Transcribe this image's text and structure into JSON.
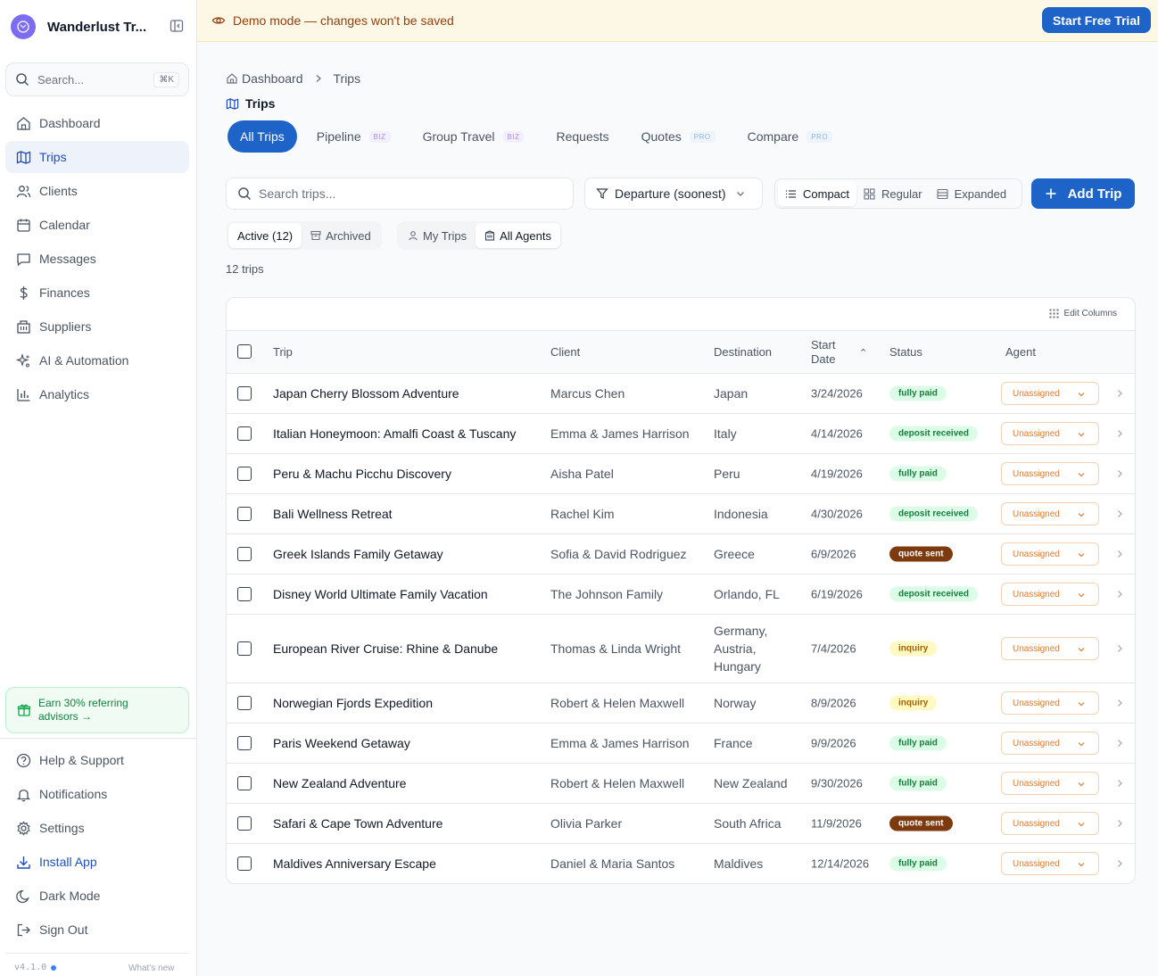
{
  "app": {
    "name": "Wanderlust Tr...",
    "version": "v4.1.0",
    "whats_new": "What's new"
  },
  "search": {
    "placeholder": "Search...",
    "shortcut": "⌘K"
  },
  "sidebar": {
    "items": [
      {
        "label": "Dashboard",
        "icon": "home-icon",
        "active": false
      },
      {
        "label": "Trips",
        "icon": "map-icon",
        "active": true
      },
      {
        "label": "Clients",
        "icon": "users-icon",
        "active": false
      },
      {
        "label": "Calendar",
        "icon": "calendar-icon",
        "active": false
      },
      {
        "label": "Messages",
        "icon": "message-icon",
        "active": false
      },
      {
        "label": "Finances",
        "icon": "dollar-icon",
        "active": false
      },
      {
        "label": "Suppliers",
        "icon": "building-icon",
        "active": false
      },
      {
        "label": "AI & Automation",
        "icon": "sparkles-icon",
        "active": false
      },
      {
        "label": "Analytics",
        "icon": "bar-chart-icon",
        "active": false
      }
    ],
    "referral": "Earn 30% referring advisors →",
    "bottom": [
      {
        "label": "Help & Support",
        "icon": "help-icon"
      },
      {
        "label": "Notifications",
        "icon": "bell-icon"
      },
      {
        "label": "Settings",
        "icon": "gear-icon"
      },
      {
        "label": "Install App",
        "icon": "download-icon"
      },
      {
        "label": "Dark Mode",
        "icon": "moon-icon"
      },
      {
        "label": "Sign Out",
        "icon": "sign-out-icon"
      }
    ]
  },
  "banner": {
    "text": "Demo mode — changes won't be saved",
    "cta": "Start Free Trial"
  },
  "breadcrumb": {
    "root": "Dashboard",
    "current": "Trips"
  },
  "page": {
    "title": "Trips"
  },
  "tabs": [
    {
      "label": "All Trips",
      "tier": "",
      "active": true
    },
    {
      "label": "Pipeline",
      "tier": "BIZ",
      "active": false
    },
    {
      "label": "Group Travel",
      "tier": "BIZ",
      "active": false
    },
    {
      "label": "Requests",
      "tier": "",
      "active": false
    },
    {
      "label": "Quotes",
      "tier": "PRO",
      "active": false
    },
    {
      "label": "Compare",
      "tier": "PRO",
      "active": false
    }
  ],
  "toolbar": {
    "search_placeholder": "Search trips...",
    "sort": "Departure (soonest)",
    "density": [
      "Compact",
      "Regular",
      "Expanded"
    ],
    "density_selected": "Compact",
    "add": "Add Trip"
  },
  "filters": {
    "status": [
      {
        "label": "Active (12)",
        "active": true
      },
      {
        "label": "Archived",
        "active": false
      }
    ],
    "agent": [
      {
        "label": "My Trips",
        "active": false
      },
      {
        "label": "All Agents",
        "active": true
      }
    ]
  },
  "count_text": "12 trips",
  "table": {
    "edit_columns": "Edit Columns",
    "headers": {
      "trip": "Trip",
      "client": "Client",
      "destination": "Destination",
      "start_date_1": "Start",
      "start_date_2": "Date",
      "status": "Status",
      "agent": "Agent"
    },
    "sort_indicator": "⌃",
    "rows": [
      {
        "trip": "Japan Cherry Blossom Adventure",
        "client": "Marcus Chen",
        "destination": "Japan",
        "date": "3/24/2026",
        "status": "fully paid",
        "agent": "Unassigned"
      },
      {
        "trip": "Italian Honeymoon: Amalfi Coast & Tuscany",
        "client": "Emma & James Harrison",
        "destination": "Italy",
        "date": "4/14/2026",
        "status": "deposit received",
        "agent": "Unassigned"
      },
      {
        "trip": "Peru & Machu Picchu Discovery",
        "client": "Aisha Patel",
        "destination": "Peru",
        "date": "4/19/2026",
        "status": "fully paid",
        "agent": "Unassigned"
      },
      {
        "trip": "Bali Wellness Retreat",
        "client": "Rachel Kim",
        "destination": "Indonesia",
        "date": "4/30/2026",
        "status": "deposit received",
        "agent": "Unassigned"
      },
      {
        "trip": "Greek Islands Family Getaway",
        "client": "Sofia & David Rodriguez",
        "destination": "Greece",
        "date": "6/9/2026",
        "status": "quote sent",
        "agent": "Unassigned"
      },
      {
        "trip": "Disney World Ultimate Family Vacation",
        "client": "The Johnson Family",
        "destination": "Orlando, FL",
        "date": "6/19/2026",
        "status": "deposit received",
        "agent": "Unassigned"
      },
      {
        "trip": "European River Cruise: Rhine & Danube",
        "client": "Thomas & Linda Wright",
        "destination": "Germany, Austria, Hungary",
        "date": "7/4/2026",
        "status": "inquiry",
        "agent": "Unassigned"
      },
      {
        "trip": "Norwegian Fjords Expedition",
        "client": "Robert & Helen Maxwell",
        "destination": "Norway",
        "date": "8/9/2026",
        "status": "inquiry",
        "agent": "Unassigned"
      },
      {
        "trip": "Paris Weekend Getaway",
        "client": "Emma & James Harrison",
        "destination": "France",
        "date": "9/9/2026",
        "status": "fully paid",
        "agent": "Unassigned"
      },
      {
        "trip": "New Zealand Adventure",
        "client": "Robert & Helen Maxwell",
        "destination": "New Zealand",
        "date": "9/30/2026",
        "status": "fully paid",
        "agent": "Unassigned"
      },
      {
        "trip": "Safari & Cape Town Adventure",
        "client": "Olivia Parker",
        "destination": "South Africa",
        "date": "11/9/2026",
        "status": "quote sent",
        "agent": "Unassigned"
      },
      {
        "trip": "Maldives Anniversary Escape",
        "client": "Daniel & Maria Santos",
        "destination": "Maldives",
        "date": "12/14/2026",
        "status": "fully paid",
        "agent": "Unassigned"
      }
    ]
  },
  "status_colors": {
    "fully paid": {
      "bg": "#dcfce7",
      "fg": "#15803d"
    },
    "deposit received": {
      "bg": "#dcfce7",
      "fg": "#15803d"
    },
    "quote sent": {
      "bg": "#7c3a0e",
      "fg": "#ffffff"
    },
    "inquiry": {
      "bg": "#fef9c3",
      "fg": "#a16207"
    }
  },
  "colors": {
    "accent": "#1e63c8",
    "banner_bg": "#fdf8e6",
    "banner_text": "#92400e",
    "agent_text": "#e07a2e"
  }
}
